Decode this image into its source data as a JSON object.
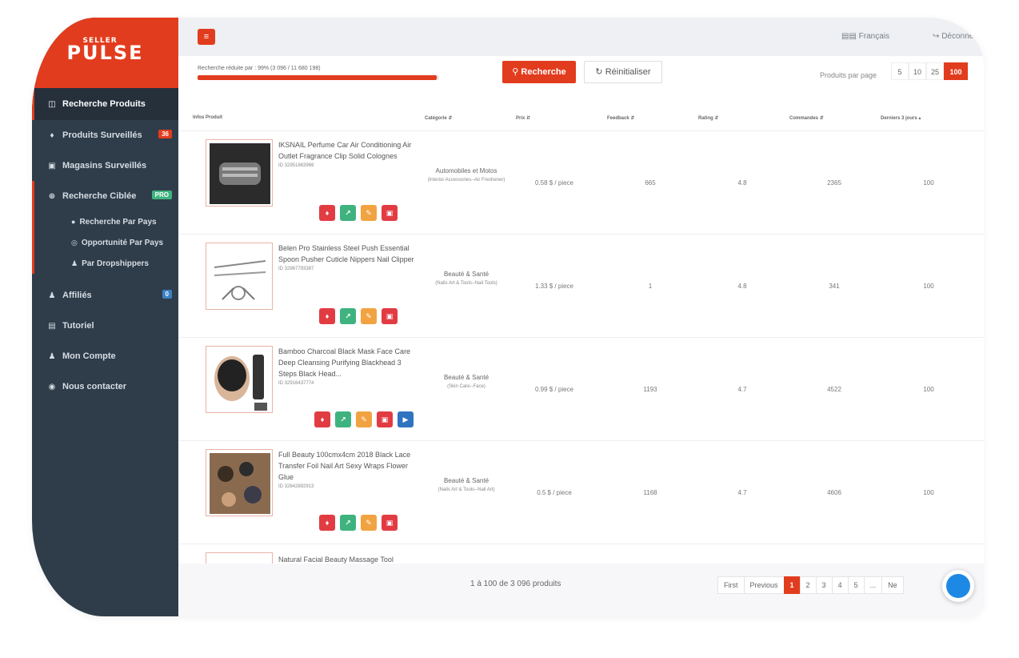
{
  "logo": {
    "top": "SELLER",
    "main": "PULSE"
  },
  "sidebar": {
    "items": [
      {
        "label": "Recherche Produits",
        "icon": "database-icon"
      },
      {
        "label": "Produits Surveillés",
        "icon": "bell-icon",
        "badge": "36"
      },
      {
        "label": "Magasins Surveillés",
        "icon": "store-icon"
      },
      {
        "label": "Recherche Ciblée",
        "icon": "globe-icon",
        "badge": "PRO"
      },
      {
        "label": "Affiliés",
        "icon": "users-icon",
        "badge": "0"
      },
      {
        "label": "Tutoriel",
        "icon": "book-icon"
      },
      {
        "label": "Mon Compte",
        "icon": "user-icon"
      },
      {
        "label": "Nous contacter",
        "icon": "contact-icon"
      }
    ],
    "subitems": [
      {
        "label": "Recherche Par Pays",
        "icon": "globe-icon"
      },
      {
        "label": "Opportunité Par Pays",
        "icon": "target-icon"
      },
      {
        "label": "Par Dropshippers",
        "icon": "user-icon"
      }
    ]
  },
  "topbar": {
    "language": "Français",
    "logout": "Déconnexio"
  },
  "search": {
    "filter_text": "Recherche réduite par : 99% (3 096 / 11 680 198)",
    "progress": 0.99,
    "search_label": "Recherche",
    "reset_label": "Réinitialiser",
    "per_page_label": "Produits par page",
    "per_page_options": [
      "5",
      "10",
      "25",
      "100"
    ],
    "per_page_selected": "100"
  },
  "table": {
    "headers": [
      "Infos Produit",
      "Catégorie",
      "Prix",
      "Feedback",
      "Rating",
      "Commandes",
      "Derniers 3 jours"
    ],
    "rows": [
      {
        "name": "IKSNAIL Perfume Car Air Conditioning Air Outlet Fragrance Clip Solid Colognes",
        "id": "ID 32951863969",
        "category": "Automobiles et Motos",
        "subcategory": "(Interior Accessories--Air Freshener)",
        "price": "0.58 $ / piece",
        "feedback": "665",
        "rating": "4.8",
        "orders": "2365",
        "last3": "100"
      },
      {
        "name": "Belen Pro Stainless Steel Push Essential Spoon Pusher Cuticle Nippers Nail Clipper",
        "id": "ID 32967793387",
        "category": "Beauté & Santé",
        "subcategory": "(Nails Art & Tools--Nail Tools)",
        "price": "1.33 $ / piece",
        "feedback": "1",
        "rating": "4.8",
        "orders": "341",
        "last3": "100"
      },
      {
        "name": "Bamboo Charcoal Black Mask Face Care Deep Cleansing Purifying Blackhead 3 Steps Black Head...",
        "id": "ID 32916437774",
        "category": "Beauté & Santé",
        "subcategory": "(Skin Care--Face)",
        "price": "0.99 $ / piece",
        "feedback": "1193",
        "rating": "4.7",
        "orders": "4522",
        "last3": "100"
      },
      {
        "name": "Full Beauty 100cmx4cm 2018 Black Lace Transfer Foil Nail Art Sexy Wraps Flower Glue",
        "id": "ID 32642892913",
        "category": "Beauté & Santé",
        "subcategory": "(Nails Art & Tools--Nail Art)",
        "price": "0.5 $ / piece",
        "feedback": "1168",
        "rating": "4.7",
        "orders": "4606",
        "last3": "100"
      }
    ],
    "next_row_name": "Natural Facial Beauty Massage Tool"
  },
  "footer": {
    "count_text": "1 à 100 de 3 096 produits",
    "pages": [
      "First",
      "Previous",
      "1",
      "2",
      "3",
      "4",
      "5",
      "...",
      "Ne"
    ],
    "active_page": "1"
  },
  "colors": {
    "accent": "#e23c1e",
    "sidebar": "#2f3d4a",
    "green": "#3fb37f",
    "orange": "#f2a341",
    "blue": "#2e74c0"
  }
}
